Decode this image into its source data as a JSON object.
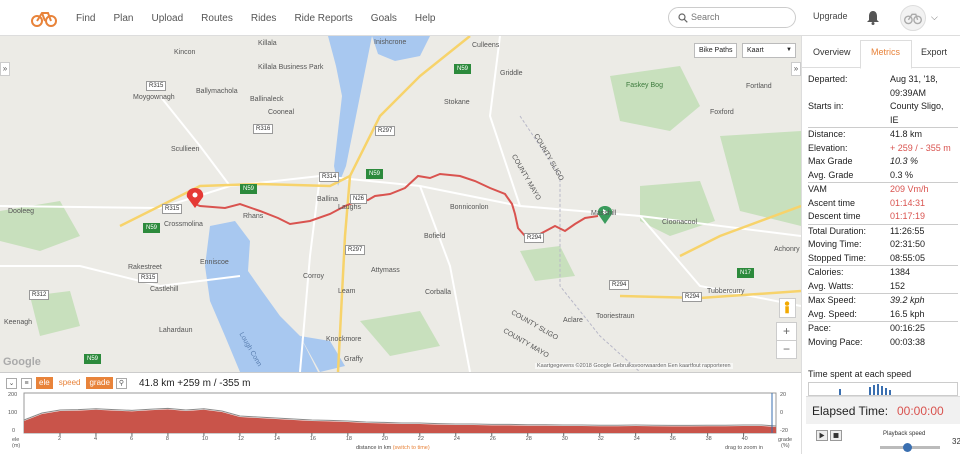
{
  "nav": {
    "links": [
      "Find",
      "Plan",
      "Upload",
      "Routes",
      "Rides",
      "Ride Reports",
      "Goals",
      "Help"
    ],
    "search_placeholder": "Search",
    "upgrade": "Upgrade"
  },
  "map": {
    "bike_paths_label": "Bike Paths",
    "layer_select": "Kaart",
    "google_logo": "Google",
    "attribution": "Kaartgegevens ©2018 Google    Gebruiksvoorwaarden    Een kaartfout rapporteren",
    "zoom_in": "+",
    "zoom_out": "−",
    "towns": [
      "Kincon",
      "Killala",
      "Killala Business Park",
      "Inishcrone",
      "Culleens",
      "Griddle",
      "Ballinaleck",
      "Ballymachola",
      "Cooneal",
      "Stokane",
      "Foxford",
      "Fortland",
      "Moygownagh",
      "Scullieen",
      "Crossmolina",
      "Rhans",
      "Ballina",
      "Laughs",
      "Bonniconlon",
      "Bofield",
      "Masshill",
      "Cloonacool",
      "Dooleeg",
      "Enniscoe",
      "Rakestreet",
      "Castlehill",
      "Corroy",
      "Attymass",
      "Corballa",
      "Aclare",
      "Tooriestraun",
      "Tubbercurry",
      "Achonry",
      "Keenagh",
      "Lahardaun",
      "Knockmore",
      "Graffy",
      "Leam",
      "Lough Conn",
      "COUNTY SLIGO",
      "COUNTY MAYO",
      "COUNTY MAYO",
      "COUNTY SLIGO",
      "Faskey Bog"
    ],
    "roads": [
      "R315",
      "R316",
      "N59",
      "N59",
      "N59",
      "R314",
      "N26",
      "R297",
      "N59",
      "R294",
      "R294",
      "R294",
      "N17",
      "R312",
      "R315",
      "R315",
      "N59",
      "R297"
    ]
  },
  "elevation": {
    "tags": [
      "ele",
      "speed",
      "grade"
    ],
    "summary": "41.8 km +259 m / -355 m",
    "y_ticks": [
      "200",
      "100",
      "0"
    ],
    "y_unit_top": "ele",
    "y_unit_bottom": "(m)",
    "right_ticks": [
      "20",
      "0",
      "-20"
    ],
    "right_unit_top": "grade",
    "right_unit_bottom": "(%)",
    "x_ticks": [
      "2",
      "4",
      "6",
      "8",
      "10",
      "12",
      "14",
      "16",
      "18",
      "20",
      "22",
      "24",
      "26",
      "28",
      "30",
      "32",
      "34",
      "36",
      "38",
      "40"
    ],
    "x_label": "distance in km",
    "x_switch": "(switch to time)",
    "drag_hint": "drag to zoom in",
    "profile": [
      [
        0,
        60
      ],
      [
        1,
        95
      ],
      [
        2,
        110
      ],
      [
        3,
        112
      ],
      [
        4,
        116
      ],
      [
        5,
        112
      ],
      [
        6,
        108
      ],
      [
        7,
        114
      ],
      [
        8,
        118
      ],
      [
        9,
        110
      ],
      [
        10,
        116
      ],
      [
        11,
        105
      ],
      [
        12,
        80
      ],
      [
        13,
        75
      ],
      [
        14,
        70
      ],
      [
        15,
        65
      ],
      [
        16,
        60
      ],
      [
        17,
        58
      ],
      [
        18,
        55
      ],
      [
        19,
        50
      ],
      [
        20,
        48
      ],
      [
        21,
        45
      ],
      [
        22,
        45
      ],
      [
        23,
        42
      ],
      [
        24,
        40
      ],
      [
        25,
        40
      ],
      [
        26,
        38
      ],
      [
        27,
        38
      ],
      [
        28,
        36
      ],
      [
        29,
        36
      ],
      [
        30,
        35
      ],
      [
        31,
        35
      ],
      [
        32,
        34
      ],
      [
        33,
        34
      ],
      [
        34,
        35
      ],
      [
        35,
        34
      ],
      [
        36,
        33
      ],
      [
        37,
        33
      ],
      [
        38,
        34
      ],
      [
        39,
        34
      ],
      [
        40,
        35
      ],
      [
        41,
        35
      ],
      [
        41.8,
        30
      ]
    ]
  },
  "panel": {
    "tabs": [
      "Overview",
      "Metrics",
      "Export"
    ],
    "metrics": [
      {
        "k": "Departed:",
        "v": "Aug 31, '18,",
        "cls": ""
      },
      {
        "k": "",
        "v": "09:39AM",
        "cls": ""
      },
      {
        "k": "Starts in:",
        "v": "County Sligo,",
        "cls": ""
      },
      {
        "k": "",
        "v": "IE",
        "cls": ""
      },
      {
        "k": "Distance:",
        "v": "41.8 km",
        "cls": ""
      },
      {
        "k": "Elevation:",
        "v": "+ 259 / - 355 m",
        "cls": "red"
      },
      {
        "k": "Max Grade",
        "v": "10.3 %",
        "cls": "it"
      },
      {
        "k": "Avg. Grade",
        "v": "0.3 %",
        "cls": ""
      },
      {
        "k": "VAM",
        "v": "209 Vm/h",
        "cls": "red"
      },
      {
        "k": "Ascent time",
        "v": "01:14:31",
        "cls": "red"
      },
      {
        "k": "Descent time",
        "v": "01:17:19",
        "cls": "red"
      },
      {
        "k": "Total Duration:",
        "v": "11:26:55",
        "cls": ""
      },
      {
        "k": "Moving Time:",
        "v": "02:31:50",
        "cls": ""
      },
      {
        "k": "Stopped Time:",
        "v": "08:55:05",
        "cls": ""
      },
      {
        "k": "Calories:",
        "v": "1384",
        "cls": ""
      },
      {
        "k": "Avg. Watts:",
        "v": "152",
        "cls": ""
      },
      {
        "k": "Max Speed:",
        "v": "39.2 kph",
        "cls": "it"
      },
      {
        "k": "Avg. Speed:",
        "v": "16.5 kph",
        "cls": ""
      },
      {
        "k": "Pace:",
        "v": "00:16:25",
        "cls": ""
      },
      {
        "k": "Moving Pace:",
        "v": "00:03:38",
        "cls": ""
      }
    ],
    "time_spent": "Time spent at each speed",
    "elapsed_label": "Elapsed Time:",
    "elapsed_value": "00:00:00",
    "playback_speed": "Playback speed",
    "playback_value": "32"
  },
  "colors": {
    "accent": "#e8833a",
    "route": "#d9534f",
    "water": "#a8c8f0",
    "park": "#c8e0bd"
  }
}
